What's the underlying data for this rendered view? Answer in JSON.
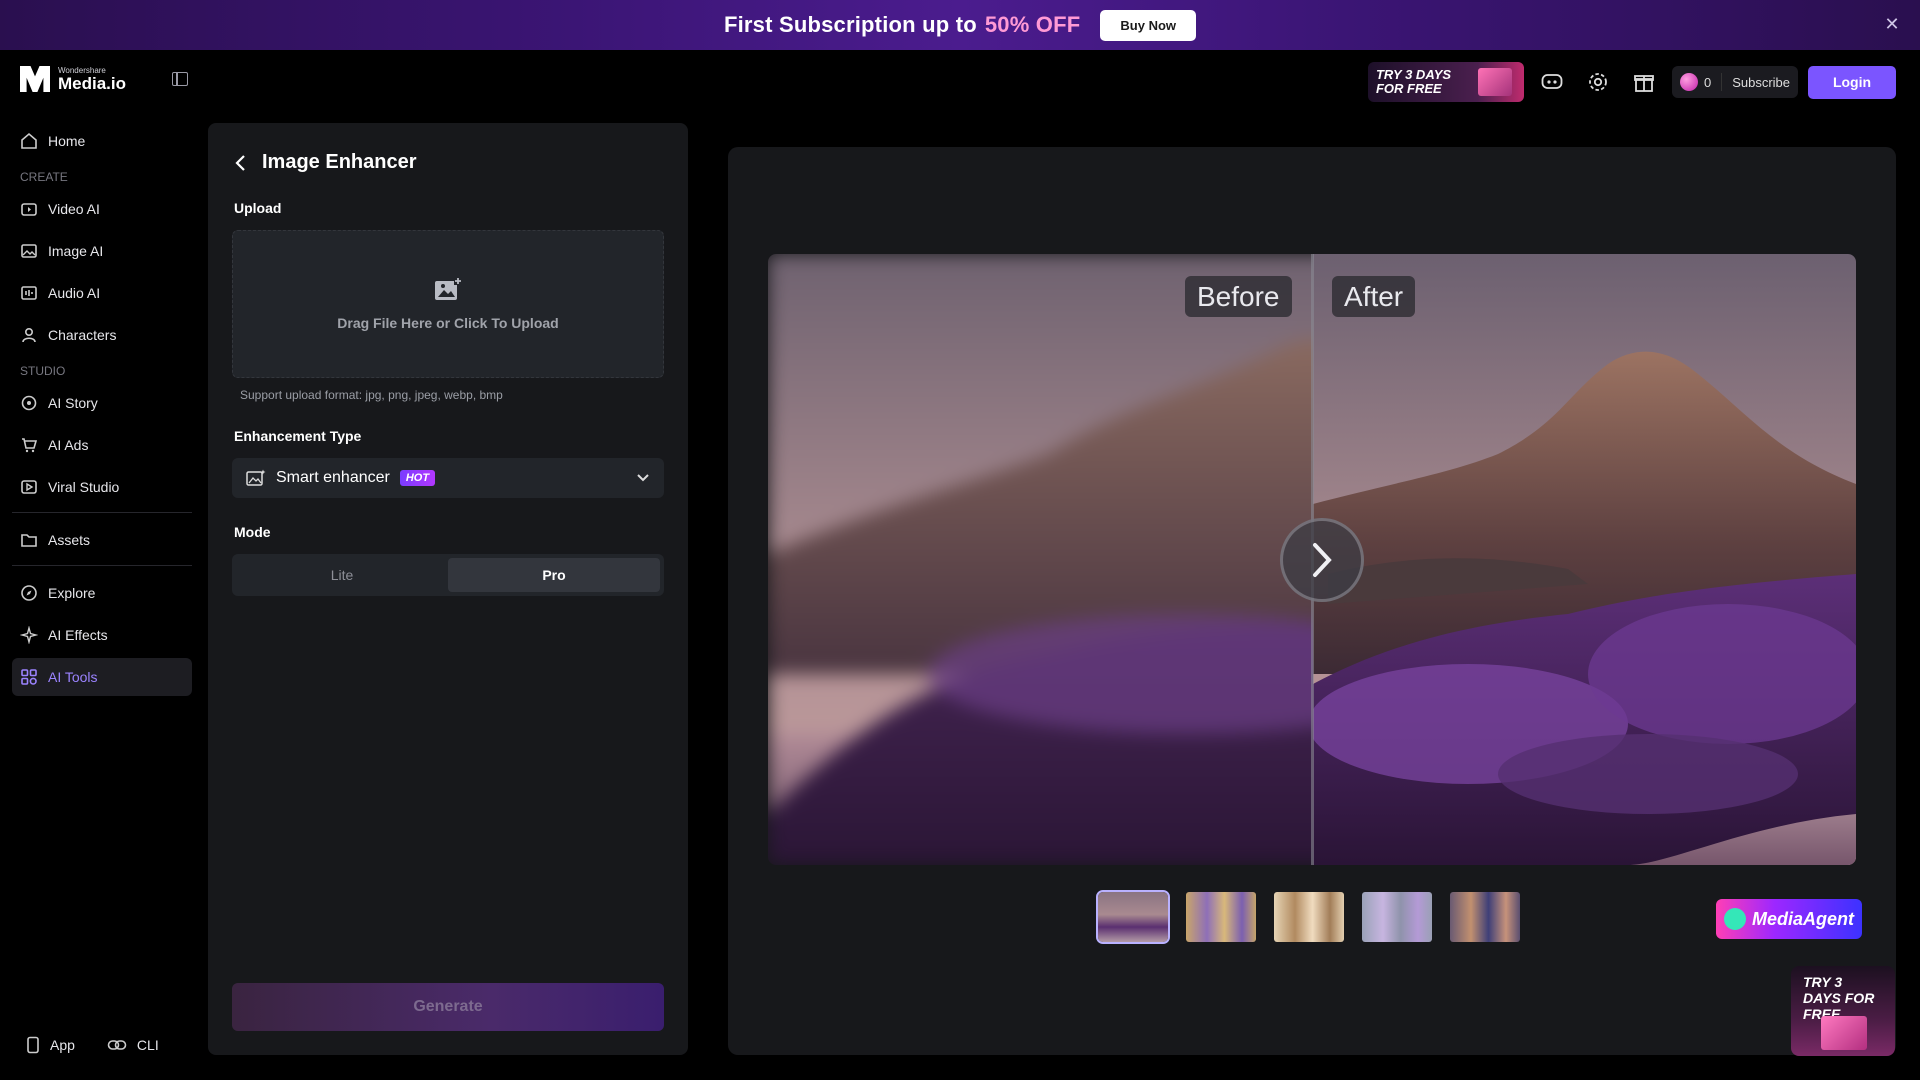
{
  "banner": {
    "text": "First Subscription up to",
    "highlight": "50% OFF",
    "button": "Buy Now",
    "close_icon": "close-icon"
  },
  "header": {
    "logo_small": "Wondershare",
    "logo_big": "Media.io",
    "trial_badge": "TRY 3 DAYS FOR FREE",
    "credits": "0",
    "subscribe": "Subscribe",
    "login": "Login",
    "icons": [
      "discord-icon",
      "gear-icon",
      "gift-icon",
      "gem-icon"
    ]
  },
  "sidebar": {
    "home": "Home",
    "section_create": "CREATE",
    "video_ai": "Video AI",
    "image_ai": "Image AI",
    "audio_ai": "Audio AI",
    "characters": "Characters",
    "section_studio": "STUDIO",
    "ai_story": "AI Story",
    "ai_ads": "AI Ads",
    "viral_studio": "Viral Studio",
    "assets": "Assets",
    "explore": "Explore",
    "ai_effects": "AI Effects",
    "ai_tools": "AI Tools",
    "app": "App",
    "cli": "CLI"
  },
  "panel": {
    "title": "Image Enhancer",
    "upload_label": "Upload",
    "upload_text": "Drag File Here or Click To Upload",
    "upload_hint": "Support upload format: jpg, png, jpeg, webp, bmp",
    "enhancement_label": "Enhancement Type",
    "enhancement_value": "Smart enhancer",
    "hot_badge": "HOT",
    "mode_label": "Mode",
    "mode_lite": "Lite",
    "mode_pro": "Pro",
    "generate": "Generate"
  },
  "preview": {
    "before": "Before",
    "after": "After",
    "media_agent": "MediaAgent",
    "trial_float": "TRY 3 DAYS FOR FREE"
  },
  "colors": {
    "accent": "#7b55ff",
    "active_nav": "#9b83ff",
    "panel_bg": "#17181b"
  }
}
